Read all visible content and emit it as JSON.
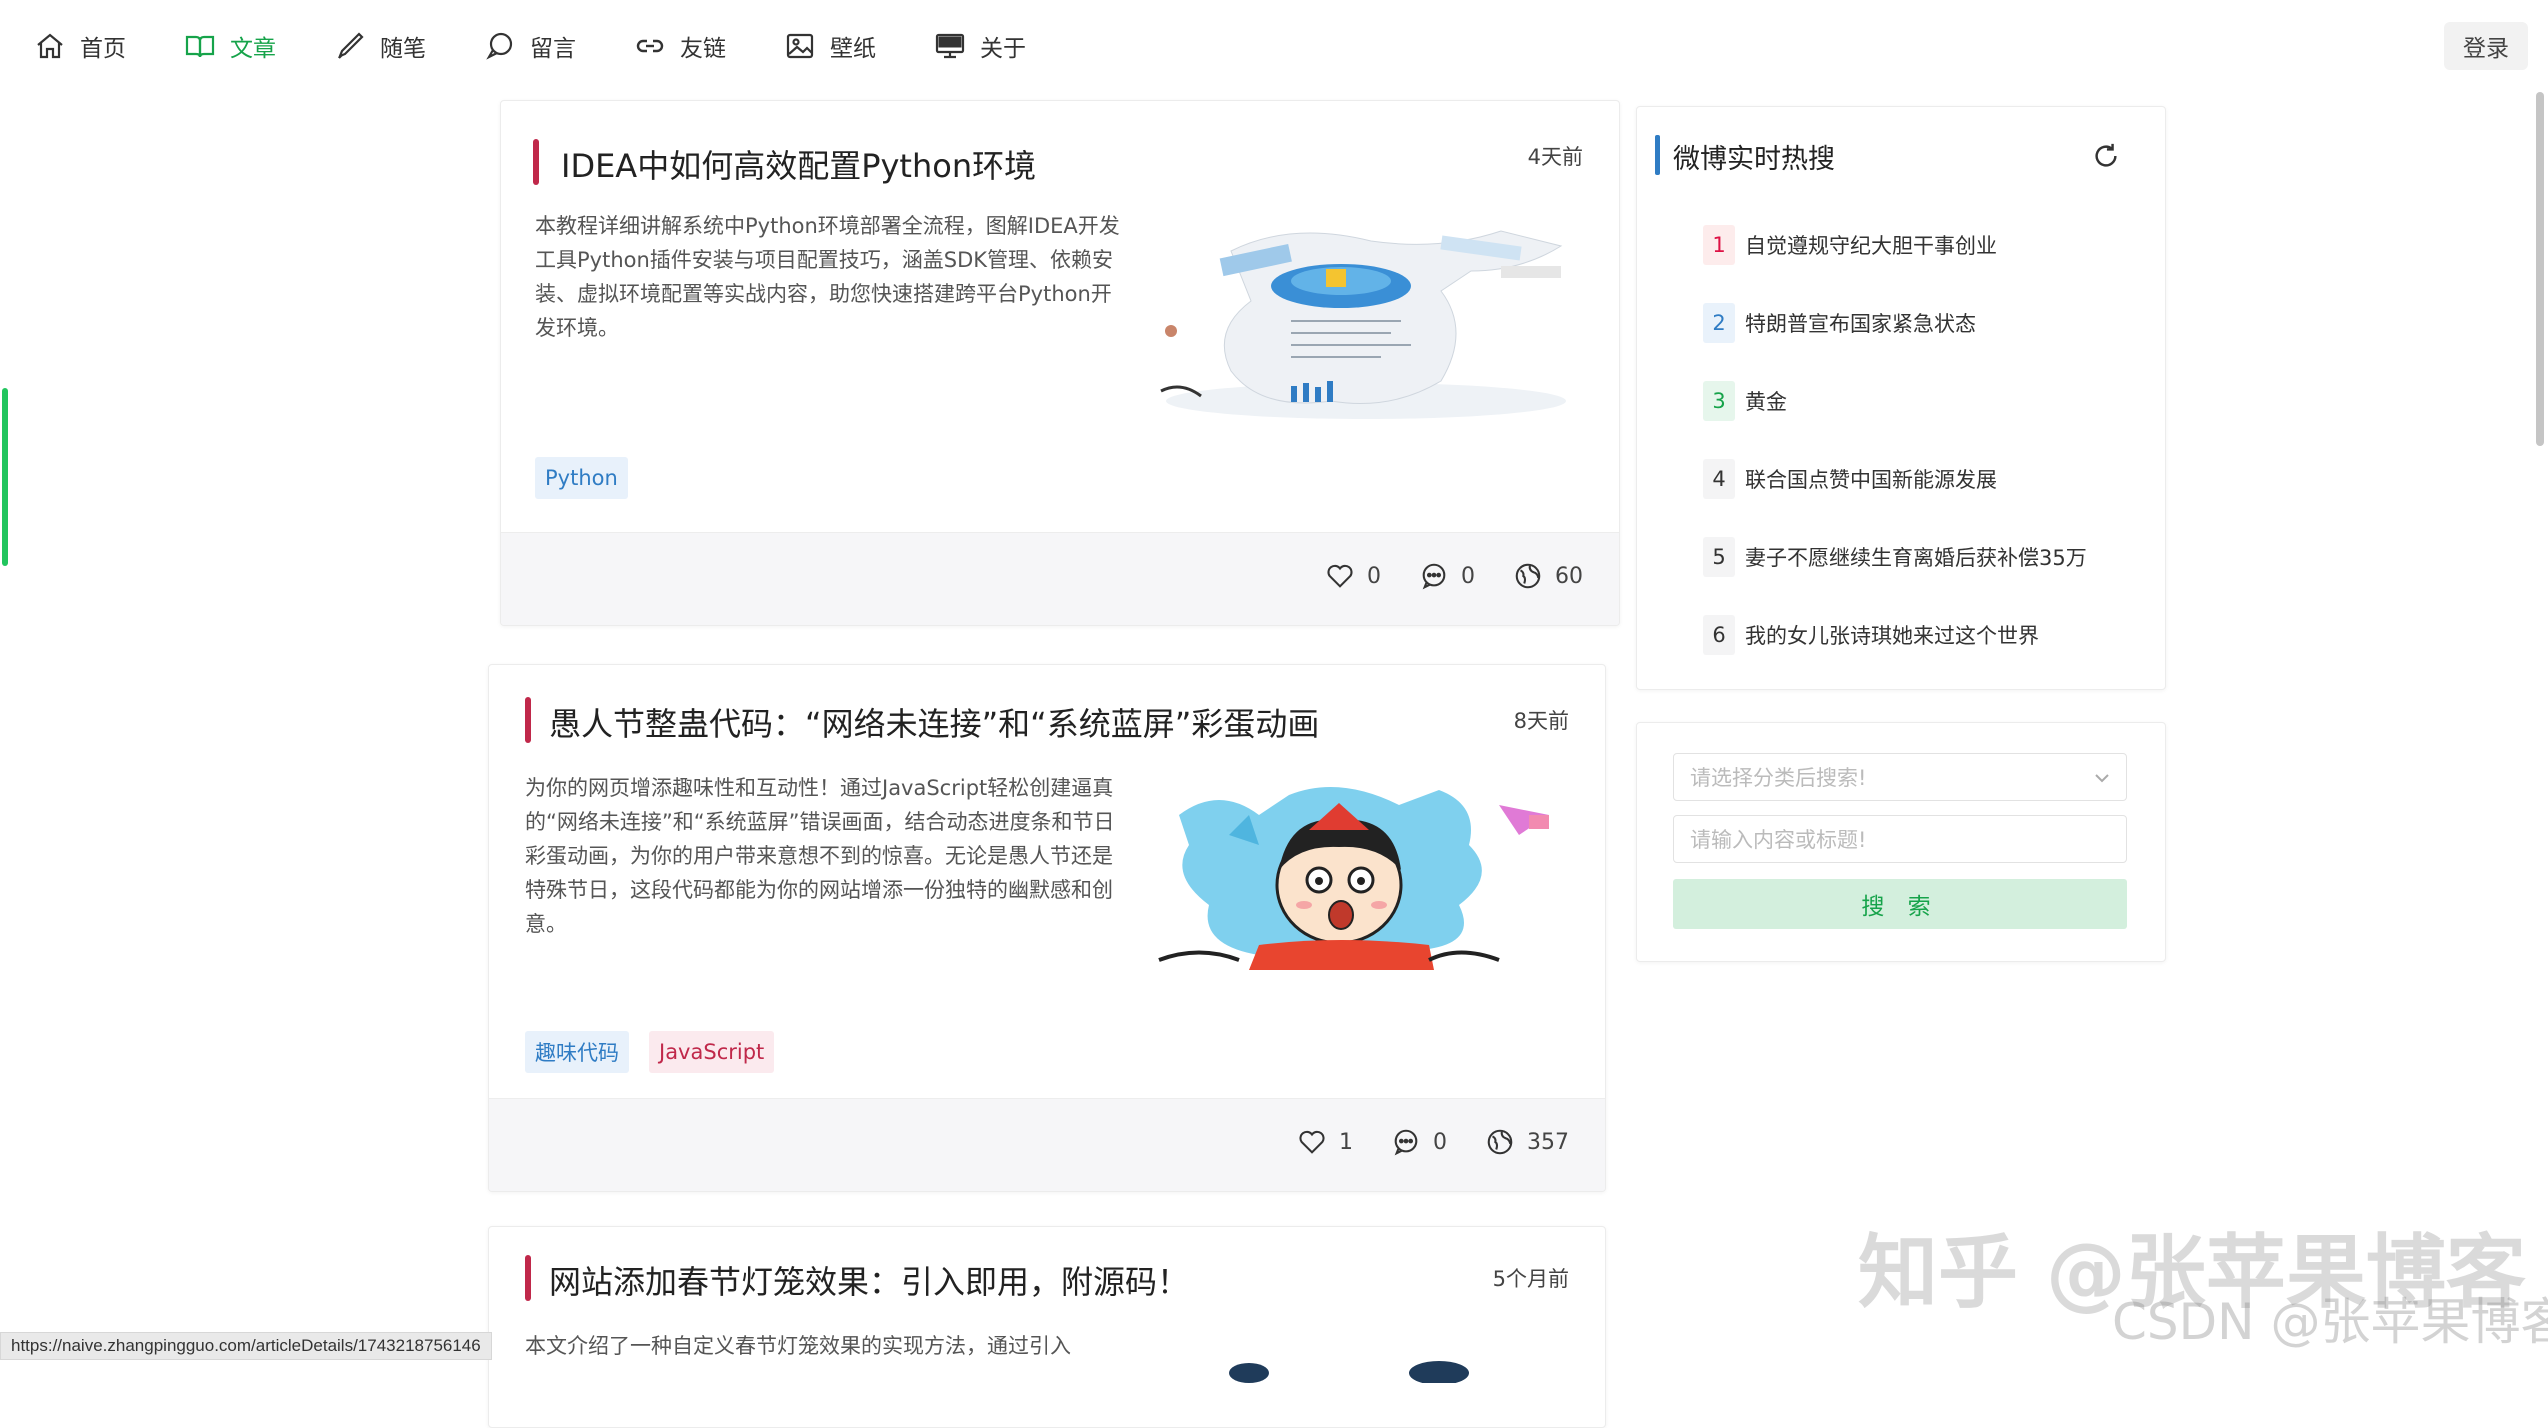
{
  "nav": {
    "items": [
      {
        "label": "首页",
        "icon": "home-icon"
      },
      {
        "label": "文章",
        "icon": "book-icon",
        "active": true
      },
      {
        "label": "随笔",
        "icon": "pen-icon"
      },
      {
        "label": "留言",
        "icon": "message-icon"
      },
      {
        "label": "友链",
        "icon": "link-icon"
      },
      {
        "label": "壁纸",
        "icon": "image-icon"
      },
      {
        "label": "关于",
        "icon": "monitor-icon"
      }
    ],
    "login_label": "登录"
  },
  "articles": [
    {
      "title": "IDEA中如何高效配置Python环境",
      "time": "4天前",
      "description": "本教程详细讲解系统中Python环境部署全流程，图解IDEA开发工具Python插件安装与项目配置技巧，涵盖SDK管理、依赖安装、虚拟环境配置等实战内容，助您快速搭建跨平台Python开发环境。",
      "tags": [
        {
          "label": "Python",
          "color": "blue"
        }
      ],
      "likes": "0",
      "comments": "0",
      "views": "60"
    },
    {
      "title": "愚人节整蛊代码：“网络未连接”和“系统蓝屏”彩蛋动画",
      "time": "8天前",
      "description": "为你的网页增添趣味性和互动性！通过JavaScript轻松创建逼真的“网络未连接”和“系统蓝屏”错误画面，结合动态进度条和节日彩蛋动画，为你的用户带来意想不到的惊喜。无论是愚人节还是特殊节日，这段代码都能为你的网站增添一份独特的幽默感和创意。",
      "tags": [
        {
          "label": "趣味代码",
          "color": "blue"
        },
        {
          "label": "JavaScript",
          "color": "pink"
        }
      ],
      "likes": "1",
      "comments": "0",
      "views": "357"
    },
    {
      "title": "网站添加春节灯笼效果：引入即用，附源码！",
      "time": "5个月前",
      "description": "本文介绍了一种自定义春节灯笼效果的实现方法，通过引入"
    }
  ],
  "hot": {
    "title": "微博实时热搜",
    "items": [
      {
        "rank": "1",
        "text": "自觉遵规守纪大胆干事创业"
      },
      {
        "rank": "2",
        "text": "特朗普宣布国家紧急状态"
      },
      {
        "rank": "3",
        "text": "黄金"
      },
      {
        "rank": "4",
        "text": "联合国点赞中国新能源发展"
      },
      {
        "rank": "5",
        "text": "妻子不愿继续生育离婚后获补偿35万"
      },
      {
        "rank": "6",
        "text": "我的女儿张诗琪她来过这个世界"
      }
    ]
  },
  "search": {
    "category_placeholder": "请选择分类后搜索!",
    "input_placeholder": "请输入内容或标题!",
    "button_label": "搜 索"
  },
  "status_url": "https://naive.zhangpingguo.com/articleDetails/1743218756146",
  "watermarks": {
    "primary": "知乎 @张苹果博客",
    "secondary": "CSDN @张苹果博客"
  },
  "colors": {
    "accent_green": "#16a34a",
    "title_bar_red": "#c0284a",
    "hot_bar_blue": "#2f7cc4"
  }
}
